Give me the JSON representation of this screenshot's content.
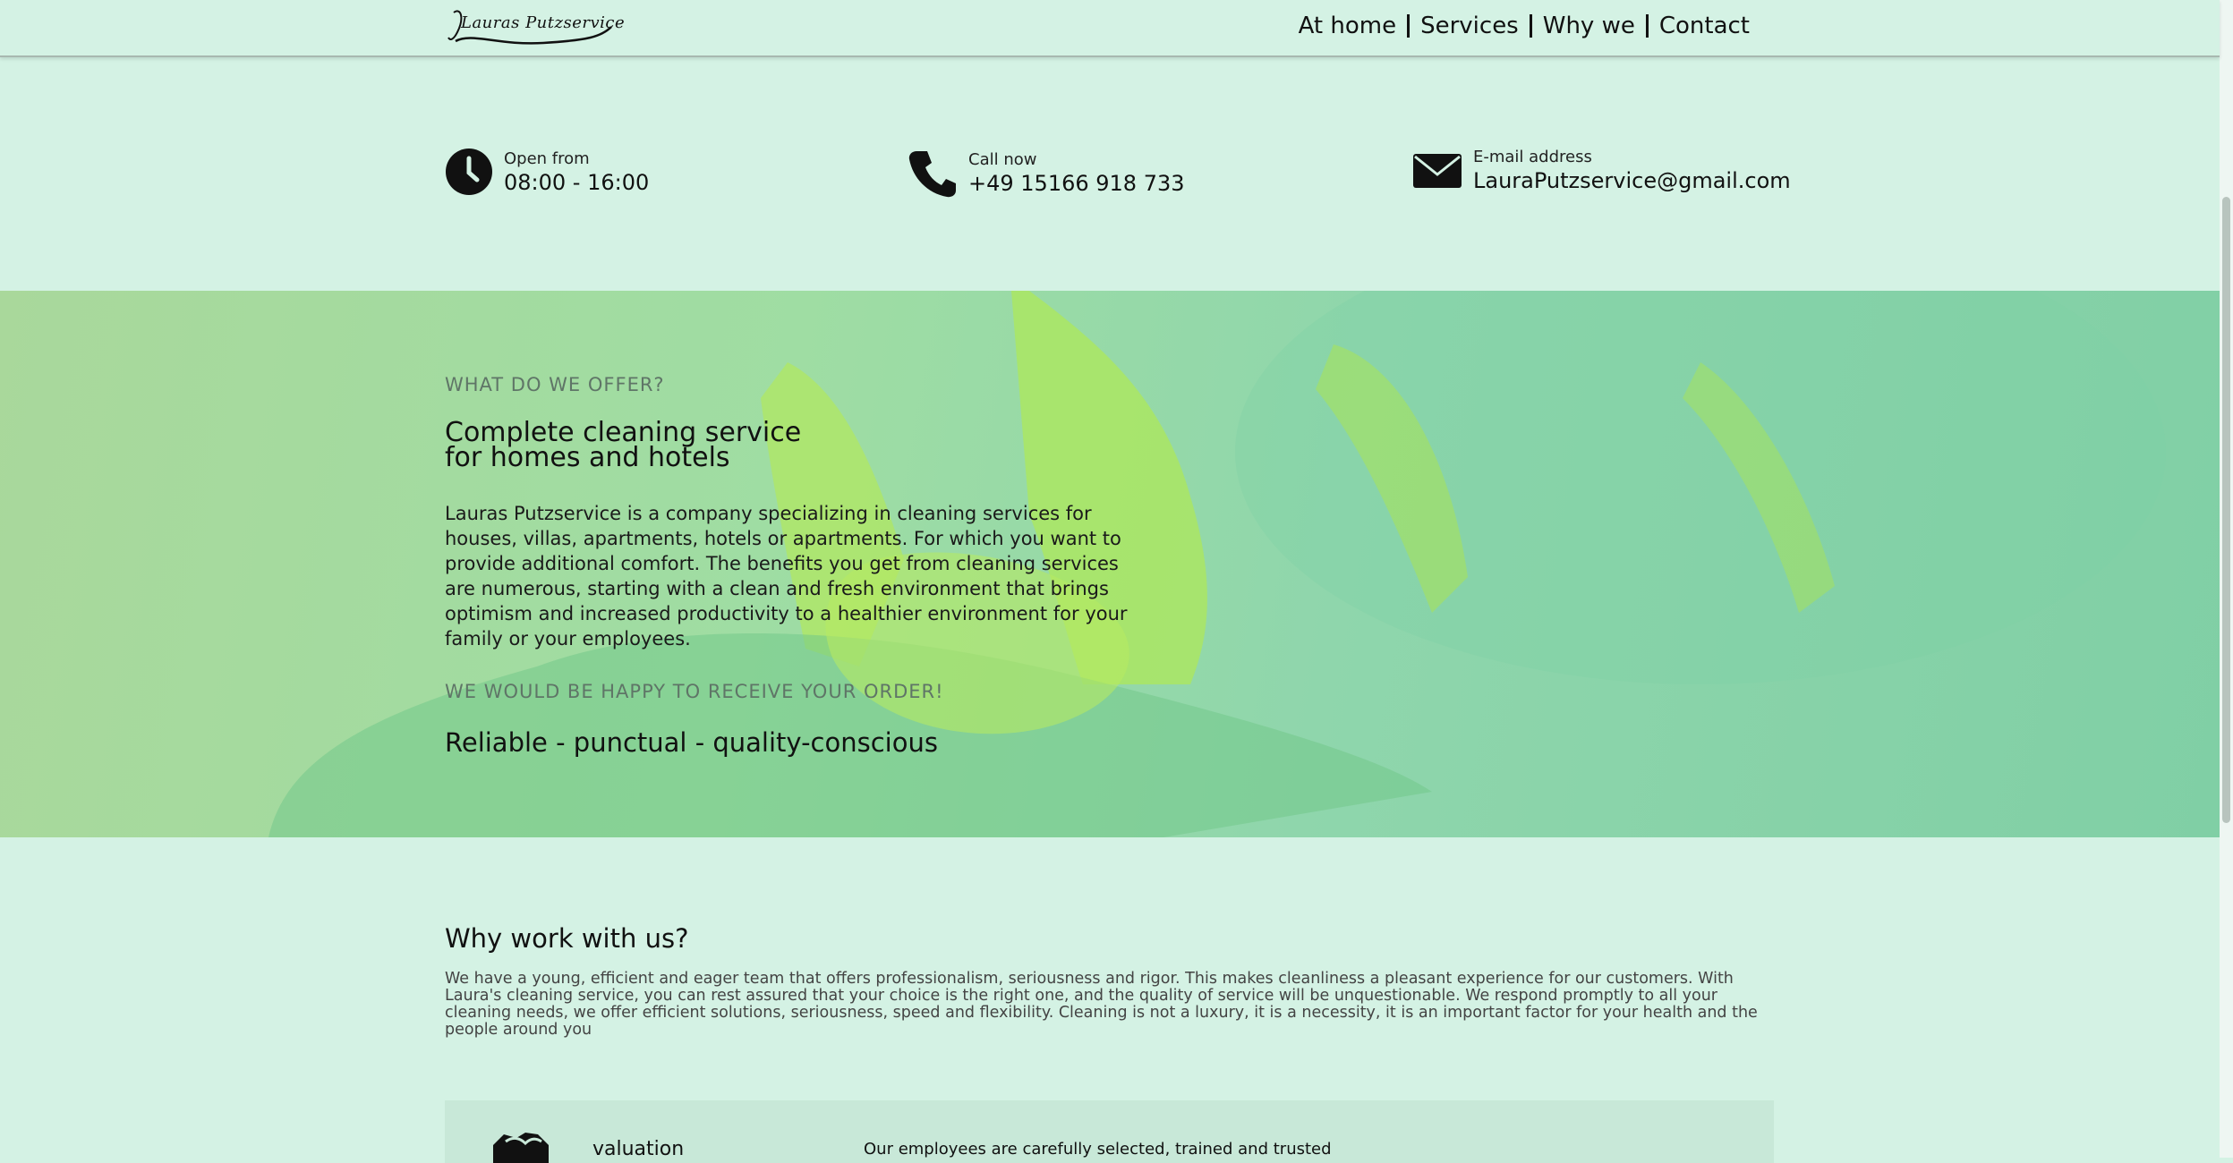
{
  "header": {
    "logo_text": "Lauras Putzservice",
    "nav": [
      "At home",
      "Services",
      "Why we",
      "Contact"
    ]
  },
  "contact_bar": {
    "hours": {
      "label": "Open from",
      "value": "08:00 - 16:00",
      "icon": "clock-icon"
    },
    "phone": {
      "label": "Call now",
      "value": "+49 15166 918 733",
      "icon": "phone-icon"
    },
    "email": {
      "label": "E-mail address",
      "value": "LauraPutzservice@gmail.com",
      "icon": "envelope-icon"
    }
  },
  "hero": {
    "kicker": "WHAT DO WE OFFER?",
    "title": "Complete cleaning service for homes and hotels",
    "body": "Lauras Putzservice is a company specializing in cleaning services for houses, villas, apartments, hotels or apartments. For which you want to provide additional comfort. The benefits you get from cleaning services are numerous, starting with a clean and fresh environment that brings optimism and increased productivity to a healthier environment for your family or your employees.",
    "kicker2": "WE WOULD BE HAPPY TO RECEIVE YOUR ORDER!",
    "tagline": "Reliable - punctual - quality-conscious"
  },
  "why": {
    "title": "Why work with us?",
    "text": "We have a young, efficient and eager team that offers professionalism, seriousness and rigor. This makes cleanliness a pleasant experience for our customers. With Laura's cleaning service, you can rest assured that your choice is the right one, and the quality of service will be unquestionable. We respond promptly to all your cleaning needs, we offer efficient solutions, seriousness, speed and flexibility. Cleaning is not a luxury, it is a necessity, it is an important factor for your health and the people around you"
  },
  "cards": [
    {
      "icon": "handshake-icon",
      "title": "valuation",
      "text": "Our employees are carefully selected, trained and trusted"
    }
  ],
  "colors": {
    "page_bg": "#d4f2e4",
    "hero_tint": "#8fd6ac",
    "muted_text": "#5f7567"
  }
}
